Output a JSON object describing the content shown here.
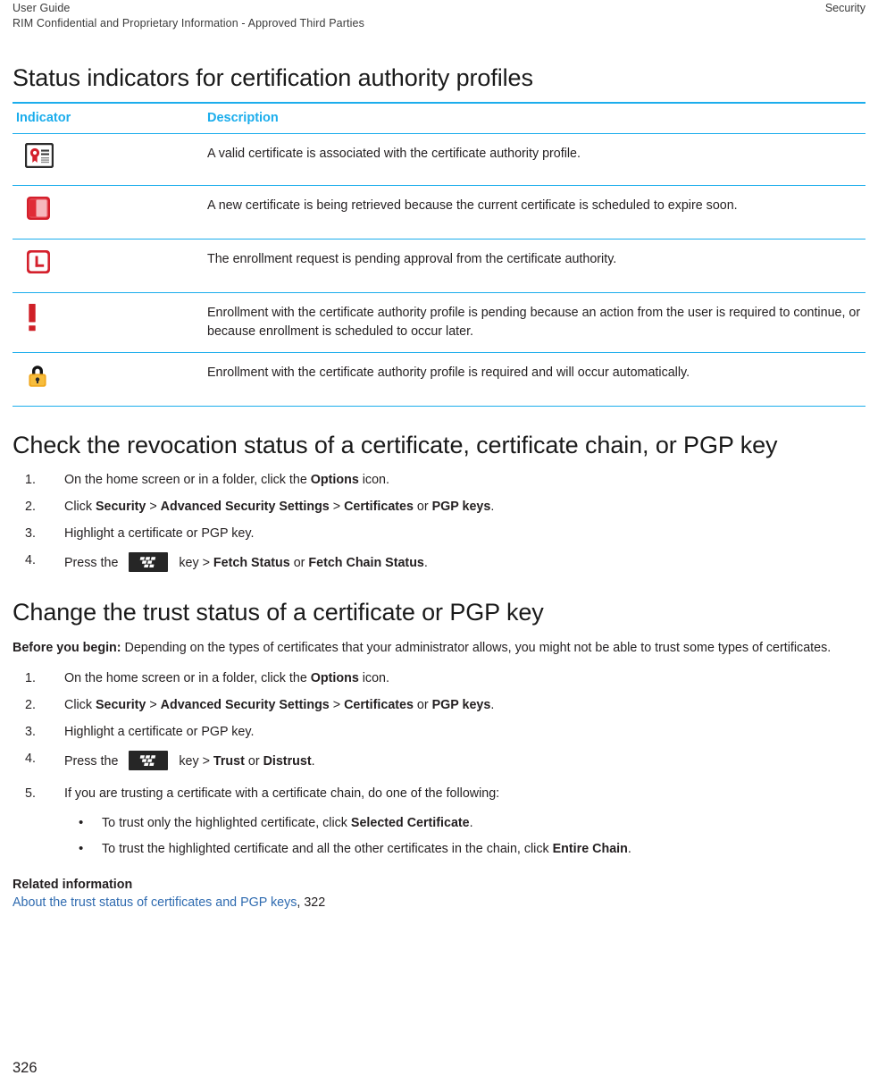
{
  "running_header": {
    "left_line1": "User Guide",
    "left_line2": "RIM Confidential and Proprietary Information - Approved Third Parties",
    "right": "Security"
  },
  "section1": {
    "title": "Status indicators for certification authority profiles",
    "table": {
      "columns": [
        "Indicator",
        "Description"
      ],
      "rows": [
        {
          "icon": "certificate-seal-icon",
          "description": "A valid certificate is associated with the certificate authority profile."
        },
        {
          "icon": "certificate-renewing-icon",
          "description": "A new certificate is being retrieved because the current certificate is scheduled to expire soon."
        },
        {
          "icon": "clock-pending-icon",
          "description": "The enrollment request is pending approval from the certificate authority."
        },
        {
          "icon": "exclamation-icon",
          "description": "Enrollment with the certificate authority profile is pending because an action from the user is required to continue, or because enrollment is scheduled to occur later."
        },
        {
          "icon": "lock-icon",
          "description": "Enrollment with the certificate authority profile is required and will occur automatically."
        }
      ]
    }
  },
  "section2": {
    "title": "Check the revocation status of a certificate, certificate chain, or PGP key",
    "steps": [
      {
        "parts": [
          {
            "t": "On the home screen or in a folder, click the ",
            "b": false
          },
          {
            "t": "Options",
            "b": true
          },
          {
            "t": " icon.",
            "b": false
          }
        ]
      },
      {
        "parts": [
          {
            "t": "Click ",
            "b": false
          },
          {
            "t": "Security",
            "b": true
          },
          {
            "t": " > ",
            "b": false
          },
          {
            "t": "Advanced Security Settings",
            "b": true
          },
          {
            "t": " > ",
            "b": false
          },
          {
            "t": "Certificates",
            "b": true
          },
          {
            "t": " or ",
            "b": false
          },
          {
            "t": "PGP keys",
            "b": true
          },
          {
            "t": ".",
            "b": false
          }
        ]
      },
      {
        "parts": [
          {
            "t": "Highlight a certificate or PGP key.",
            "b": false
          }
        ]
      },
      {
        "key_icon": "blackberry-menu-key-icon",
        "before_key": "Press the",
        "parts": [
          {
            "t": "key > ",
            "b": false
          },
          {
            "t": "Fetch Status",
            "b": true
          },
          {
            "t": " or ",
            "b": false
          },
          {
            "t": "Fetch Chain Status",
            "b": true
          },
          {
            "t": ".",
            "b": false
          }
        ]
      }
    ]
  },
  "section3": {
    "title": "Change the trust status of a certificate or PGP key",
    "before_you_begin_label": "Before you begin:",
    "before_you_begin_text": " Depending on the types of certificates that your administrator allows, you might not be able to trust some types of certificates.",
    "steps": [
      {
        "parts": [
          {
            "t": "On the home screen or in a folder, click the ",
            "b": false
          },
          {
            "t": "Options",
            "b": true
          },
          {
            "t": " icon.",
            "b": false
          }
        ]
      },
      {
        "parts": [
          {
            "t": "Click ",
            "b": false
          },
          {
            "t": "Security",
            "b": true
          },
          {
            "t": " > ",
            "b": false
          },
          {
            "t": "Advanced Security Settings",
            "b": true
          },
          {
            "t": " > ",
            "b": false
          },
          {
            "t": "Certificates",
            "b": true
          },
          {
            "t": " or ",
            "b": false
          },
          {
            "t": "PGP keys",
            "b": true
          },
          {
            "t": ".",
            "b": false
          }
        ]
      },
      {
        "parts": [
          {
            "t": "Highlight a certificate or PGP key.",
            "b": false
          }
        ]
      },
      {
        "key_icon": "blackberry-menu-key-icon",
        "before_key": "Press the",
        "parts": [
          {
            "t": "key > ",
            "b": false
          },
          {
            "t": "Trust",
            "b": true
          },
          {
            "t": " or ",
            "b": false
          },
          {
            "t": "Distrust",
            "b": true
          },
          {
            "t": ".",
            "b": false
          }
        ]
      },
      {
        "parts": [
          {
            "t": "If you are trusting a certificate with a certificate chain, do one of the following:",
            "b": false
          }
        ],
        "bullets": [
          {
            "parts": [
              {
                "t": "To trust only the highlighted certificate, click ",
                "b": false
              },
              {
                "t": "Selected Certificate",
                "b": true
              },
              {
                "t": ".",
                "b": false
              }
            ]
          },
          {
            "parts": [
              {
                "t": "To trust the highlighted certificate and all the other certificates in the chain, click ",
                "b": false
              },
              {
                "t": "Entire Chain",
                "b": true
              },
              {
                "t": ".",
                "b": false
              }
            ]
          }
        ]
      }
    ],
    "related_information_label": "Related information",
    "related_link_text": "About the trust status of certificates and PGP keys",
    "related_link_page": ", 322"
  },
  "footer": {
    "page_number": "326"
  },
  "colors": {
    "table_rule": "#1badec",
    "table_header_text": "#1badec",
    "link": "#2f6bb0",
    "body_text": "#231f20",
    "icon_red": "#d4202c",
    "icon_gold": "#f0a81e",
    "key_dark": "#262626"
  }
}
